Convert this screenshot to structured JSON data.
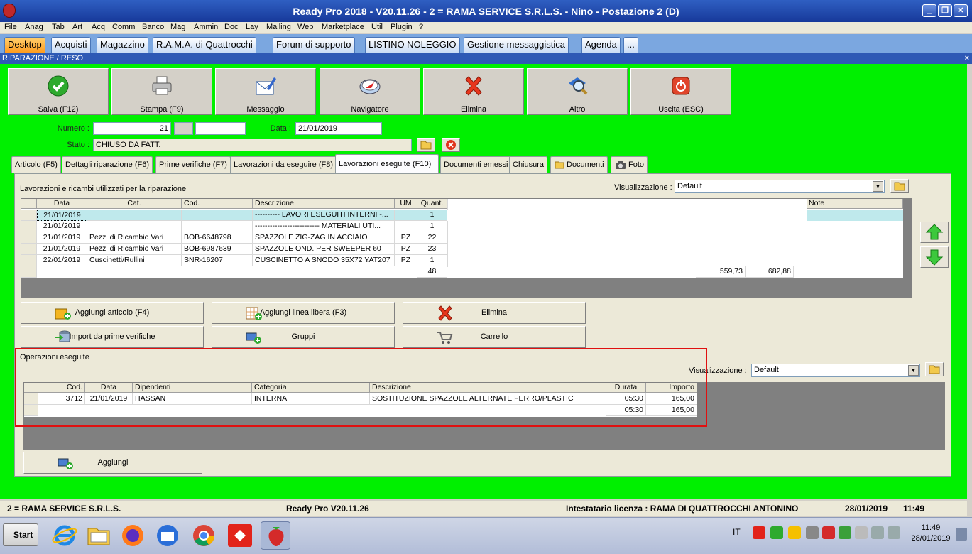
{
  "window": {
    "title": "Ready Pro 2018 - V20.11.26 - 2 = RAMA SERVICE S.R.L.S. - Nino - Postazione 2 (D)",
    "min": "_",
    "max": "❐",
    "close": "✕"
  },
  "menu": [
    "File",
    "Anag",
    "Tab",
    "Art",
    "Acq",
    "Comm",
    "Banco",
    "Mag",
    "Ammin",
    "Doc",
    "Lay",
    "Mailing",
    "Web",
    "Marketplace",
    "Util",
    "Plugin",
    "?"
  ],
  "app_tabs": [
    "Desktop",
    "Acquisti",
    "Magazzino",
    "R.A.M.A. di Quattrocchi",
    "Forum di supporto",
    "LISTINO NOLEGGIO",
    "Gestione messaggistica",
    "Agenda",
    "..."
  ],
  "form": {
    "title": "RIPARAZIONE / RESO",
    "close": "×"
  },
  "toolbar": [
    "Salva (F12)",
    "Stampa (F9)",
    "Messaggio",
    "Navigatore",
    "Elimina",
    "Altro",
    "Uscita (ESC)"
  ],
  "fields": {
    "numero_label": "Numero :",
    "numero_value": "21",
    "data_label": "Data :",
    "data_value": "21/01/2019",
    "stato_label": "Stato :",
    "stato_value": "CHIUSO DA FATT."
  },
  "form_tabs": [
    "Articolo (F5)",
    "Dettagli riparazione (F6)",
    "Prime verifiche (F7)",
    "Lavorazioni da eseguire (F8)",
    "Lavorazioni eseguite (F10)",
    "Documenti emessi",
    "Chiusura",
    "Documenti",
    "Foto"
  ],
  "lavorazioni": {
    "caption": "Lavorazioni e ricambi utilizzati per la riparazione",
    "view_label": "Visualizzazione :",
    "view_value": "Default",
    "columns": [
      "Data",
      "Cat.",
      "Cod.",
      "Descrizione",
      "UM",
      "Quant.",
      "Note"
    ],
    "rows": [
      {
        "data": "21/01/2019",
        "cat": "",
        "cod": "",
        "desc": "---------- LAVORI ESEGUITI INTERNI -...",
        "um": "",
        "qty": "1"
      },
      {
        "data": "21/01/2019",
        "cat": "",
        "cod": "",
        "desc": "-------------------------- MATERIALI UTI...",
        "um": "",
        "qty": "1"
      },
      {
        "data": "21/01/2019",
        "cat": "Pezzi di Ricambio Vari",
        "cod": "BOB-6648798",
        "desc": "SPAZZOLE ZIG-ZAG IN ACCIAIO",
        "um": "PZ",
        "qty": "22"
      },
      {
        "data": "21/01/2019",
        "cat": "Pezzi di Ricambio Vari",
        "cod": "BOB-6987639",
        "desc": "SPAZZOLE OND. PER SWEEPER 60",
        "um": "PZ",
        "qty": "23"
      },
      {
        "data": "22/01/2019",
        "cat": "Cuscinetti/Rullini",
        "cod": "SNR-16207",
        "desc": "CUSCINETTO A SNODO 35X72 YAT207",
        "um": "PZ",
        "qty": "1"
      }
    ],
    "totals": {
      "qty": "48",
      "amount1": "559,73",
      "amount2": "682,88"
    }
  },
  "actions": [
    "Aggiungi articolo (F4)",
    "Aggiungi linea libera (F3)",
    "Elimina",
    "Import da prime verifiche",
    "Gruppi",
    "Carrello"
  ],
  "operazioni": {
    "caption": "Operazioni eseguite",
    "view_label": "Visualizzazione :",
    "view_value": "Default",
    "columns": [
      "Cod.",
      "Data",
      "Dipendenti",
      "Categoria",
      "Descrizione",
      "Durata",
      "Importo"
    ],
    "rows": [
      {
        "cod": "3712",
        "data": "21/01/2019",
        "dip": "HASSAN",
        "cat": "INTERNA",
        "desc": "SOSTITUZIONE SPAZZOLE ALTERNATE FERRO/PLASTIC",
        "durata": "05:30",
        "importo": "165,00"
      }
    ],
    "totals": {
      "durata": "05:30",
      "importo": "165,00"
    },
    "add_label": "Aggiungi"
  },
  "status": {
    "company": "2 = RAMA SERVICE S.R.L.S.",
    "version": "Ready Pro V20.11.26",
    "license": "Intestatario licenza : RAMA DI QUATTROCCHI ANTONINO",
    "date": "28/01/2019",
    "time": "11:49"
  },
  "taskbar": {
    "start": "Start",
    "lang": "IT",
    "clock_time": "11:49",
    "clock_date": "28/01/2019"
  },
  "colors": {
    "form_bg": "#00f000",
    "highlight_box": "#e01010",
    "selected_row": "#bfe9ec"
  }
}
